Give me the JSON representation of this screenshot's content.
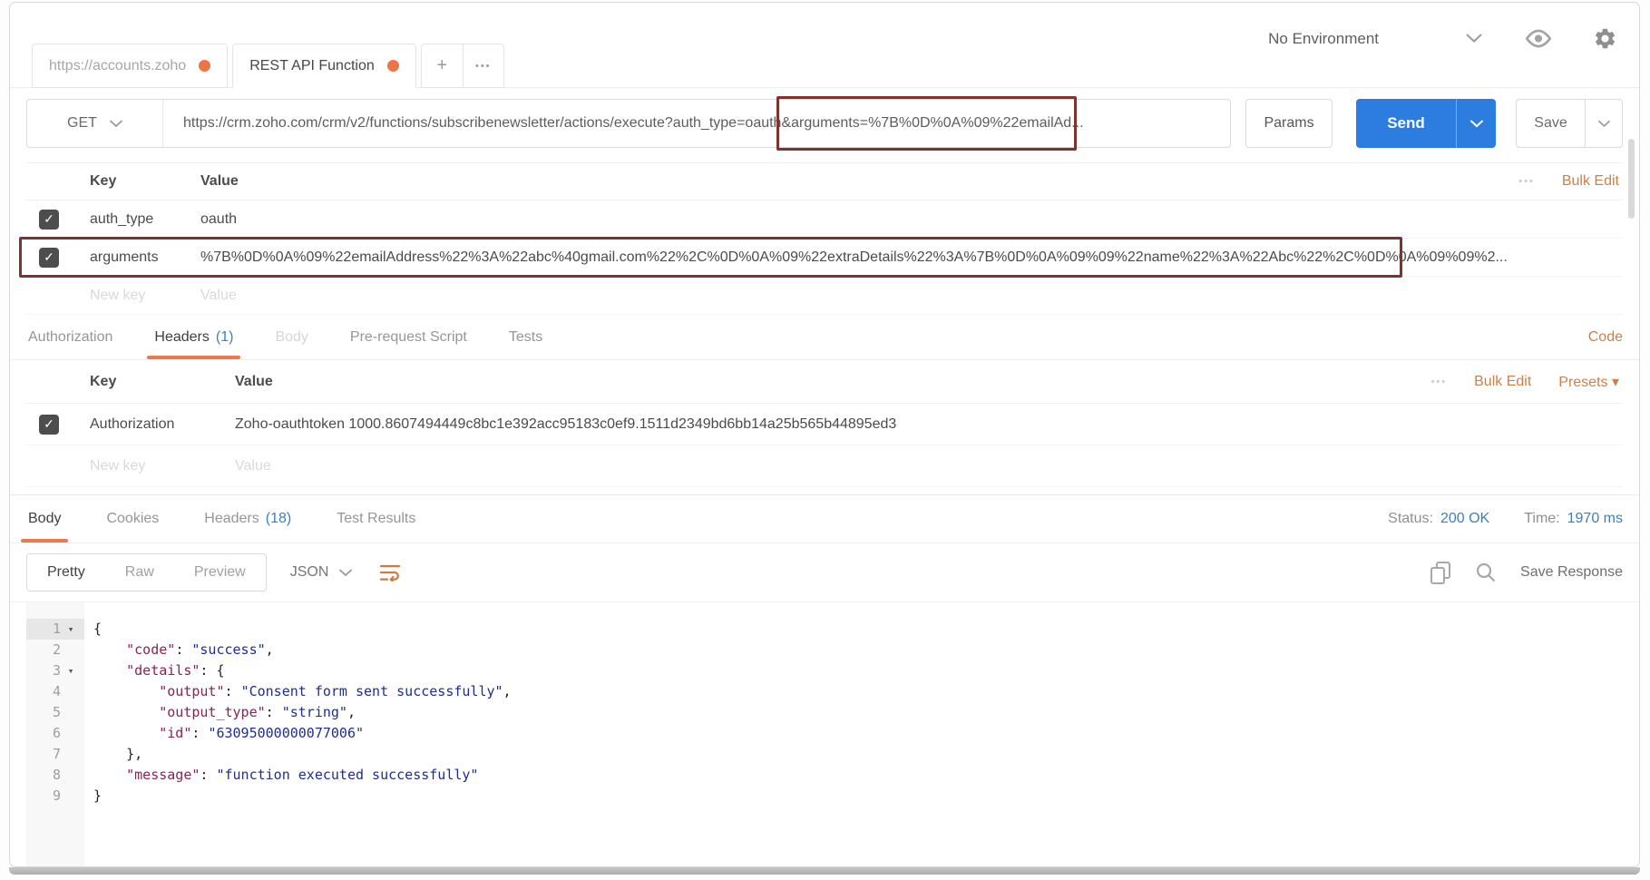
{
  "colors": {
    "accent_orange": "#e87a53",
    "link_orange": "#c8824a",
    "count_blue": "#3c80ba",
    "send_blue": "#2d7ce0",
    "annotation_maroon": "#7d342e",
    "json_key": "#8a2252",
    "json_string": "#1f2d8e"
  },
  "header": {
    "tabs": [
      {
        "label": "https://accounts.zoho"
      },
      {
        "label": "REST API Function"
      }
    ],
    "add_tab": "+",
    "more_tabs": "•••",
    "environment": {
      "selected": "No Environment"
    }
  },
  "request": {
    "method": "GET",
    "url": "https://crm.zoho.com/crm/v2/functions/subscribenewsletter/actions/execute?auth_type=oauth&arguments=%7B%0D%0A%09%22emailAd...",
    "params_button": "Params",
    "send_button": "Send",
    "save_button": "Save",
    "params": {
      "col_key": "Key",
      "col_value": "Value",
      "menu_dots": "•••",
      "bulk_edit": "Bulk Edit",
      "rows": [
        {
          "key": "auth_type",
          "value": "oauth"
        },
        {
          "key": "arguments",
          "value": "%7B%0D%0A%09%22emailAddress%22%3A%22abc%40gmail.com%22%2C%0D%0A%09%22extraDetails%22%3A%7B%0D%0A%09%09%22name%22%3A%22Abc%22%2C%0D%0A%09%09%2..."
        }
      ],
      "new_key_placeholder": "New key",
      "new_value_placeholder": "Value"
    },
    "tabs": {
      "authorization": "Authorization",
      "headers": "Headers",
      "headers_count": "(1)",
      "body": "Body",
      "prerequest": "Pre-request Script",
      "tests": "Tests",
      "code_link": "Code"
    },
    "headers_editor": {
      "col_key": "Key",
      "col_value": "Value",
      "menu_dots": "•••",
      "bulk_edit": "Bulk Edit",
      "presets": "Presets",
      "rows": [
        {
          "key": "Authorization",
          "value": "Zoho-oauthtoken 1000.8607494449c8bc1e392acc95183c0ef9.1511d2349bd6bb14a25b565b44895ed3"
        }
      ],
      "new_key_placeholder": "New key",
      "new_value_placeholder": "Value"
    }
  },
  "response": {
    "tabs": {
      "body": "Body",
      "cookies": "Cookies",
      "headers": "Headers",
      "headers_count": "(18)",
      "test_results": "Test Results"
    },
    "status_label": "Status:",
    "status_value": "200 OK",
    "time_label": "Time:",
    "time_value": "1970 ms",
    "view_modes": {
      "pretty": "Pretty",
      "raw": "Raw",
      "preview": "Preview"
    },
    "format": "JSON",
    "save_response": "Save Response",
    "code": {
      "lines": [
        {
          "n": "1",
          "fold": true,
          "tokens": [
            [
              "{",
              "p"
            ]
          ]
        },
        {
          "n": "2",
          "fold": false,
          "tokens": [
            [
              "    ",
              "p"
            ],
            [
              "\"code\"",
              "k"
            ],
            [
              ": ",
              "p"
            ],
            [
              "\"success\"",
              "s"
            ],
            [
              ",",
              "p"
            ]
          ]
        },
        {
          "n": "3",
          "fold": true,
          "tokens": [
            [
              "    ",
              "p"
            ],
            [
              "\"details\"",
              "k"
            ],
            [
              ": ",
              "p"
            ],
            [
              "{",
              "p"
            ]
          ]
        },
        {
          "n": "4",
          "fold": false,
          "tokens": [
            [
              "        ",
              "p"
            ],
            [
              "\"output\"",
              "k"
            ],
            [
              ": ",
              "p"
            ],
            [
              "\"Consent form sent successfully\"",
              "s"
            ],
            [
              ",",
              "p"
            ]
          ]
        },
        {
          "n": "5",
          "fold": false,
          "tokens": [
            [
              "        ",
              "p"
            ],
            [
              "\"output_type\"",
              "k"
            ],
            [
              ": ",
              "p"
            ],
            [
              "\"string\"",
              "s"
            ],
            [
              ",",
              "p"
            ]
          ]
        },
        {
          "n": "6",
          "fold": false,
          "tokens": [
            [
              "        ",
              "p"
            ],
            [
              "\"id\"",
              "k"
            ],
            [
              ": ",
              "p"
            ],
            [
              "\"63095000000077006\"",
              "s"
            ]
          ]
        },
        {
          "n": "7",
          "fold": false,
          "tokens": [
            [
              "    ",
              "p"
            ],
            [
              "},",
              "p"
            ]
          ]
        },
        {
          "n": "8",
          "fold": false,
          "tokens": [
            [
              "    ",
              "p"
            ],
            [
              "\"message\"",
              "k"
            ],
            [
              ": ",
              "p"
            ],
            [
              "\"function executed successfully\"",
              "s"
            ]
          ]
        },
        {
          "n": "9",
          "fold": false,
          "tokens": [
            [
              "}",
              "p"
            ]
          ]
        }
      ]
    }
  }
}
